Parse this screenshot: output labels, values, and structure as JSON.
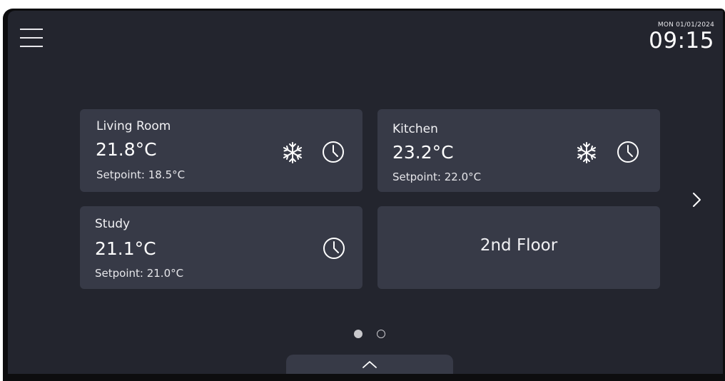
{
  "header": {
    "date": "MON 01/01/2024",
    "time": "09:15"
  },
  "zones": [
    {
      "name": "Living Room",
      "temperature": "21.8°C",
      "setpoint": "Setpoint: 18.5°C",
      "icons": [
        "snowflake-icon",
        "clock-icon"
      ]
    },
    {
      "name": "Kitchen",
      "temperature": "23.2°C",
      "setpoint": "Setpoint: 22.0°C",
      "icons": [
        "snowflake-icon",
        "clock-icon"
      ]
    },
    {
      "name": "Study",
      "temperature": "21.1°C",
      "setpoint": "Setpoint: 21.0°C",
      "icons": [
        "clock-icon"
      ]
    }
  ],
  "floor_tile": {
    "label": "2nd Floor"
  },
  "pagination": {
    "current_page": 1,
    "total_pages": 2
  },
  "icons": {
    "menu": "hamburger-menu-icon",
    "next": "chevron-right-icon",
    "drawer": "chevron-up-icon"
  },
  "colors": {
    "screen_background": "#23252e",
    "tile_background": "#373a47",
    "text": "#ffffff"
  }
}
